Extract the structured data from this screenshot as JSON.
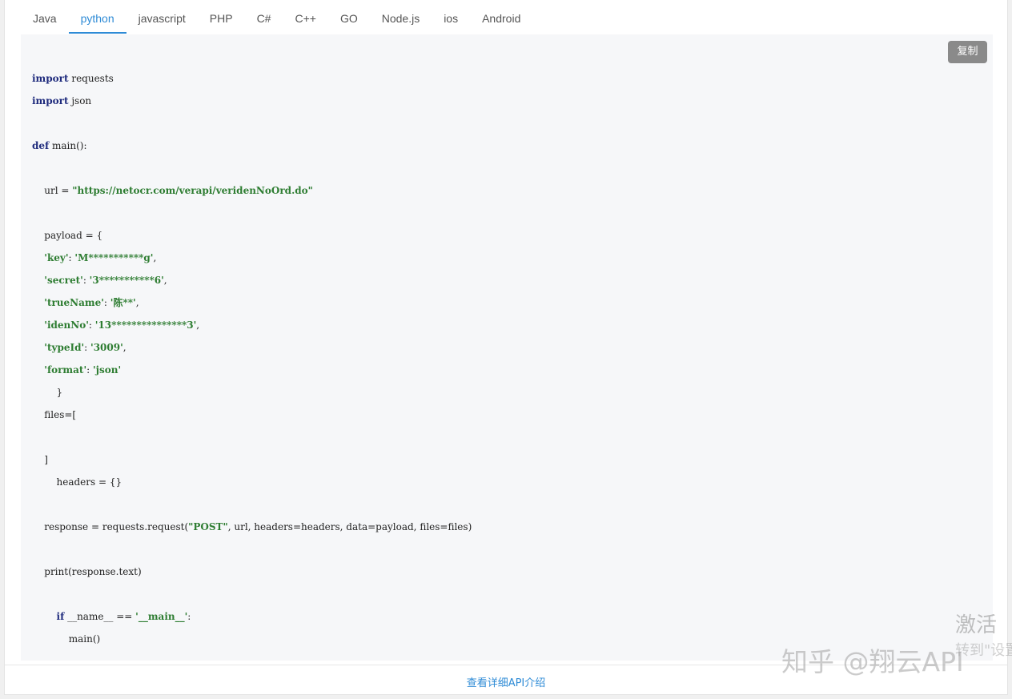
{
  "tabs": [
    {
      "label": "Java"
    },
    {
      "label": "python"
    },
    {
      "label": "javascript"
    },
    {
      "label": "PHP"
    },
    {
      "label": "C#"
    },
    {
      "label": "C++"
    },
    {
      "label": "GO"
    },
    {
      "label": "Node.js"
    },
    {
      "label": "ios"
    },
    {
      "label": "Android"
    }
  ],
  "active_tab": "python",
  "copy_label": "复制",
  "code_lines": [
    [
      [
        "kw",
        "import"
      ],
      [
        "t",
        " requests"
      ]
    ],
    [
      [
        "kw",
        "import"
      ],
      [
        "t",
        " json"
      ]
    ],
    [],
    [
      [
        "kw",
        "def"
      ],
      [
        "t",
        " main():"
      ]
    ],
    [],
    [
      [
        "t",
        "    url = "
      ],
      [
        "str",
        "\"https://netocr.com/verapi/veridenNoOrd.do\""
      ]
    ],
    [],
    [
      [
        "t",
        "    payload = {"
      ]
    ],
    [
      [
        "t",
        "    "
      ],
      [
        "str",
        "'key'"
      ],
      [
        "t",
        ": "
      ],
      [
        "str",
        "'M***********g'"
      ],
      [
        "t",
        ","
      ]
    ],
    [
      [
        "t",
        "    "
      ],
      [
        "str",
        "'secret'"
      ],
      [
        "t",
        ": "
      ],
      [
        "str",
        "'3***********6'"
      ],
      [
        "t",
        ","
      ]
    ],
    [
      [
        "t",
        "    "
      ],
      [
        "str",
        "'trueName'"
      ],
      [
        "t",
        ": "
      ],
      [
        "str",
        "'陈**'"
      ],
      [
        "t",
        ","
      ]
    ],
    [
      [
        "t",
        "    "
      ],
      [
        "str",
        "'idenNo'"
      ],
      [
        "t",
        ": "
      ],
      [
        "str",
        "'13***************3'"
      ],
      [
        "t",
        ","
      ]
    ],
    [
      [
        "t",
        "    "
      ],
      [
        "str",
        "'typeId'"
      ],
      [
        "t",
        ": "
      ],
      [
        "str",
        "'3009'"
      ],
      [
        "t",
        ","
      ]
    ],
    [
      [
        "t",
        "    "
      ],
      [
        "str",
        "'format'"
      ],
      [
        "t",
        ": "
      ],
      [
        "str",
        "'json'"
      ]
    ],
    [
      [
        "t",
        "        }"
      ]
    ],
    [
      [
        "t",
        "    files=["
      ]
    ],
    [],
    [
      [
        "t",
        "    ]"
      ]
    ],
    [
      [
        "t",
        "        headers = {}"
      ]
    ],
    [],
    [
      [
        "t",
        "    response = requests.request("
      ],
      [
        "str",
        "\"POST\""
      ],
      [
        "t",
        ", url, headers=headers, data=payload, files=files)"
      ]
    ],
    [],
    [
      [
        "t",
        "    print(response.text)"
      ]
    ],
    [],
    [
      [
        "t",
        "        "
      ],
      [
        "kw",
        "if"
      ],
      [
        "t",
        " __name__ == "
      ],
      [
        "str",
        "'__main__'"
      ],
      [
        "t",
        ":"
      ]
    ],
    [
      [
        "t",
        "            main()"
      ]
    ]
  ],
  "footer_link": "查看详细API介绍",
  "watermark_text": "知乎 @翔云API",
  "activate_line1": "激活",
  "activate_line2": "转到\"设置\"以激活",
  "colors": {
    "accent": "#2e8bd6",
    "keyword": "#1f2b7d",
    "string": "#2e7d32",
    "code_bg": "#f6f7f9"
  }
}
